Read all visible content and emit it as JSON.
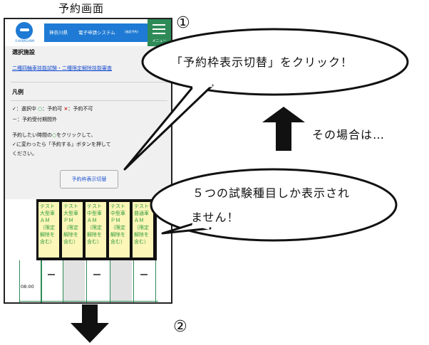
{
  "caption": "予約画面",
  "header": {
    "logo_text": "E-KANAGAWA",
    "prefecture": "神奈川県",
    "system_name": "電子申請システム",
    "system_mode": "(施設予約)",
    "menu_label": "メニュー"
  },
  "selected_facility": {
    "title": "選択施設",
    "link": "二種四輪車技能試験・二種限定解除技能審査"
  },
  "legend": {
    "title": "凡例",
    "selected_mark": "✓",
    "selected_label": "：選択中",
    "available_mark": "○",
    "available_label": "：予約可",
    "unavailable_mark": "×",
    "unavailable_label": "：予約不可",
    "out_of_period": "－：予約受付期間外"
  },
  "instructions": {
    "line1_before": "予約したい時間の",
    "line1_mark": "○",
    "line1_after": "をクリックして、",
    "line2_mark": "✓",
    "line2_text": "に変わったら「予約する」ボタンを押して",
    "line3": "ください。"
  },
  "toggle_button": "予約枠表示切替",
  "exam_columns": [
    "テスト大型車ＡＭ（限定解除を含む）",
    "テスト大型車ＰＭ（限定解除を含む）",
    "テスト中型車ＡＭ（限定解除を含む）",
    "テスト中型車ＰＭ（限定解除を含む）",
    "テスト普通車ＡＭ（限定解除を含む）"
  ],
  "time_rows": [
    {
      "time": "08:00",
      "cells": [
        "－",
        "",
        "－",
        "",
        "－"
      ]
    }
  ],
  "annotations": {
    "step1": "①",
    "step2": "②",
    "bubble_click": "「予約枠表示切替」をクリック！",
    "bubble_only5_line1": "５つの試験種目しか表示され",
    "bubble_only5_line2": "ません！",
    "side_note": "その場合は…"
  },
  "colors": {
    "header_blue": "#1e7ad4",
    "menu_green": "#2e8b57",
    "cell_yellow": "#fdf6b9",
    "available_green": "#2e9d3a",
    "unavailable_red": "#d01b1b",
    "link_blue": "#1a4fd0"
  }
}
